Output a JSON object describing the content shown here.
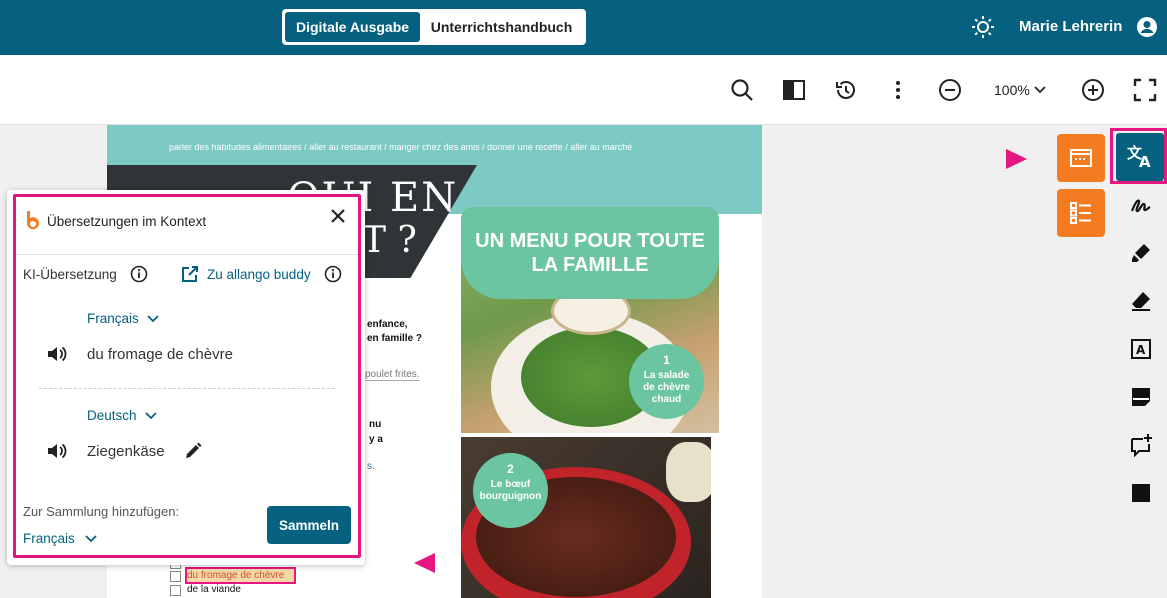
{
  "header": {
    "tab_digital": "Digitale Ausgabe",
    "tab_handbook": "Unterrichtshandbuch",
    "user_name": "Marie Lehrerin"
  },
  "toolbar": {
    "zoom": "100%"
  },
  "page": {
    "topics": "parler des habitudes alimentaires / aller au restaurant / manger chez des amis / donner une recette / aller au marché",
    "title_line1": "QUI EN",
    "title_line2": "T ?",
    "snippet1": "enfance,",
    "snippet2": "en famille ?",
    "snippet3": "poulet frites.",
    "snippet4": "nu",
    "snippet5": "y a",
    "snippet6": "s.",
    "menu_title": "UN MENU POUR TOUTE LA FAMILLE",
    "badge1_num": "1",
    "badge1_text": "La salade de chèvre chaud",
    "badge2_num": "2",
    "badge2_text": "Le bœuf bourguignon",
    "list_item1": "du fromage de chèvre",
    "list_item2": "de la viande"
  },
  "panel": {
    "title": "Übersetzungen im Kontext",
    "ki_label": "KI-Übersetzung",
    "buddy_link": "Zu allango buddy",
    "source_lang": "Français",
    "source_term": "du fromage de chèvre",
    "target_lang": "Deutsch",
    "target_term": "Ziegenkäse",
    "collection_label": "Zur Sammlung hinzufügen:",
    "collection_lang": "Français",
    "collect_button": "Sammeln"
  },
  "colors": {
    "brand": "#05617f",
    "highlight": "#e5167f",
    "orange": "#f47b20",
    "teal": "#7ccac3"
  }
}
